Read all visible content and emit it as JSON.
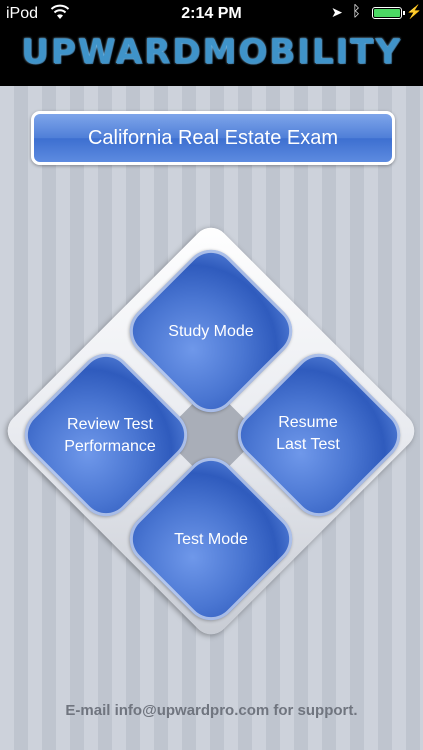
{
  "status_bar": {
    "carrier": "iPod",
    "time": "2:14 PM"
  },
  "header": {
    "logo_text": "UPWARDMOBILITY"
  },
  "exam": {
    "title": "California Real Estate Exam"
  },
  "menu": {
    "study_mode": "Study Mode",
    "review_test_line1": "Review Test",
    "review_test_line2": "Performance",
    "resume_line1": "Resume",
    "resume_line2": "Last Test",
    "test_mode": "Test Mode"
  },
  "footer": {
    "support_text": "E-mail info@upwardpro.com for support."
  },
  "colors": {
    "accent_blue": "#4f7fd8",
    "battery_green": "#4cd964"
  }
}
